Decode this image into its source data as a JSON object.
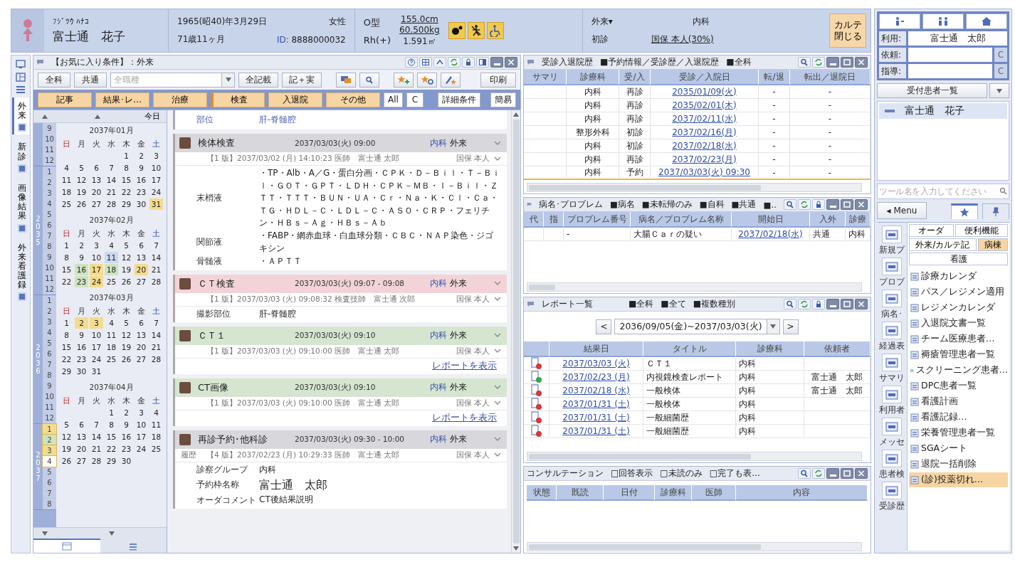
{
  "patient": {
    "kana": "ﾌｼﾞﾂｳ ﾊﾅｺ",
    "name": "富士通　花子",
    "birth": "1965(昭40)年3月29日",
    "age": "71歳11ヶ月",
    "sex": "女性",
    "id_label": "ID:",
    "id": "8888000032",
    "blood": "O型",
    "rh": "Rh(+)",
    "height": "155.0cm",
    "weight": "60.500kg",
    "bsa": "1.591㎡",
    "badges": [
      {
        "kind": "dots"
      },
      {
        "kind": "figure"
      },
      {
        "kind": "wheelchair"
      }
    ]
  },
  "visit": {
    "type": "外来▾",
    "dept": "内科",
    "visit_kind": "初診",
    "insurance": "国保 本人(30%)"
  },
  "close_button": "カルテ閉じる",
  "side_tabs": [
    {
      "label": "外来",
      "selected": true
    },
    {
      "label": "新診",
      "selected": false
    },
    {
      "label": "画像結果",
      "selected": false
    },
    {
      "label": "外来看護録",
      "selected": false
    }
  ],
  "favorites": {
    "title": "【お気に入り条件】：外来",
    "left_buttons": [
      "全科",
      "共通"
    ],
    "field_placeholder": "全職種",
    "mid_buttons": [
      "全記載",
      "記＋実"
    ],
    "print": "印刷",
    "filters": [
      {
        "label": "記事",
        "selected": false
      },
      {
        "label": "結果･レ…",
        "selected": false
      },
      {
        "label": "治療",
        "selected": false
      },
      {
        "label": "検査",
        "selected": true
      },
      {
        "label": "入退院",
        "selected": false
      },
      {
        "label": "その他",
        "selected": false
      }
    ],
    "small_buttons": [
      "All",
      "C"
    ],
    "detail": "詳細条件",
    "simple": "簡易"
  },
  "calendar": {
    "today": "今日",
    "strip": [
      {
        "months": [
          {
            "m": "9"
          },
          {
            "m": "10"
          },
          {
            "m": "11"
          },
          {
            "m": "12"
          }
        ]
      },
      {
        "year": "2035",
        "months": [
          {
            "m": "1"
          },
          {
            "m": "2"
          },
          {
            "m": "3"
          },
          {
            "m": "4"
          },
          {
            "m": "5"
          },
          {
            "m": "6"
          },
          {
            "m": "7"
          },
          {
            "m": "8"
          },
          {
            "m": "9"
          },
          {
            "m": "10"
          },
          {
            "m": "11"
          },
          {
            "m": "12"
          }
        ]
      },
      {
        "year": "2036",
        "months": [
          {
            "m": "1"
          },
          {
            "m": "2"
          },
          {
            "m": "3"
          },
          {
            "m": "4"
          },
          {
            "m": "5"
          },
          {
            "m": "6"
          },
          {
            "m": "7"
          },
          {
            "m": "8"
          },
          {
            "m": "9"
          },
          {
            "m": "10"
          },
          {
            "m": "11"
          },
          {
            "m": "12"
          }
        ]
      },
      {
        "year": "2037",
        "months": [
          {
            "m": "1",
            "color": "#f3dc8f"
          },
          {
            "m": "2",
            "color": "#cfe3c0"
          },
          {
            "m": "3",
            "color": "#f3dc8f"
          },
          {
            "m": "4",
            "color": "#ffffff"
          },
          {
            "m": "5"
          },
          {
            "m": "6"
          },
          {
            "m": "7"
          },
          {
            "m": "8"
          }
        ]
      }
    ],
    "months": [
      {
        "title": "2037年01月",
        "weekdays": [
          "日",
          "月",
          "火",
          "水",
          "木",
          "金",
          "土"
        ],
        "weeks": [
          [
            "1",
            "2",
            "3"
          ],
          [
            "4",
            "5",
            "6",
            "7",
            "8",
            "9",
            "10"
          ],
          [
            "11",
            "12",
            "13",
            "14",
            "15",
            "16",
            "17"
          ],
          [
            "18",
            "19",
            "20",
            "21",
            "22",
            "23",
            "24"
          ],
          [
            "25",
            "26",
            "27",
            "28",
            "29",
            "30",
            {
              "d": "31",
              "color": "#f3dc8f"
            }
          ]
        ]
      },
      {
        "title": "2037年02月",
        "weekdays": [
          "日",
          "月",
          "火",
          "水",
          "木",
          "金",
          "土"
        ],
        "weeks": [
          [
            "1",
            "2",
            "3",
            "4",
            "5",
            "6",
            "7"
          ],
          [
            "8",
            "9",
            "10",
            {
              "d": "11",
              "color": "#cdd8f0"
            },
            "12",
            "13",
            "14"
          ],
          [
            "15",
            {
              "d": "16",
              "color": "#cfe3c0"
            },
            {
              "d": "17",
              "color": "#f3dc8f"
            },
            {
              "d": "18",
              "color": "#cfe3c0"
            },
            "19",
            {
              "d": "20",
              "color": "#f3dc8f"
            },
            "21"
          ],
          [
            "22",
            {
              "d": "23",
              "color": "#cfe3c0"
            },
            {
              "d": "24",
              "color": "#f3dc8f"
            },
            "25",
            "26",
            "27",
            "28"
          ]
        ]
      },
      {
        "title": "2037年03月",
        "weekdays": [
          "日",
          "月",
          "火",
          "水",
          "木",
          "金",
          "土"
        ],
        "weeks": [
          [
            "1",
            {
              "d": "2",
              "color": "#f3dc8f"
            },
            {
              "d": "3",
              "color": "#f3dc8f"
            },
            "4",
            "5",
            "6",
            "7"
          ],
          [
            "8",
            "9",
            "10",
            "11",
            "12",
            "13",
            "14"
          ],
          [
            "15",
            "16",
            "17",
            "18",
            "19",
            "20",
            "21"
          ],
          [
            "22",
            "23",
            "24",
            "25",
            "26",
            "27",
            "28"
          ],
          [
            "29",
            "30",
            "31"
          ]
        ]
      },
      {
        "title": "2037年04月",
        "weekdays": [
          "日",
          "月",
          "火",
          "水",
          "木",
          "金",
          "土"
        ],
        "weeks": [
          [
            "1",
            "2",
            "3",
            "4"
          ],
          [
            "5",
            "6",
            "7",
            "8",
            "9",
            "10",
            "11"
          ],
          [
            "12",
            "13",
            "14",
            "15",
            "16",
            "17",
            "18"
          ],
          [
            "19",
            "20",
            "21",
            "22",
            "23",
            "24",
            "25"
          ],
          [
            "26",
            "27",
            "28",
            "29",
            "30"
          ]
        ]
      }
    ]
  },
  "timeline": {
    "fragment": {
      "label": "部位",
      "value": "肝-脊髄腔"
    },
    "cards": [
      {
        "title": "検体検査",
        "color": "#d8d8dc",
        "time": "2037/03/03(火) 09:00",
        "dept": "内科",
        "place": "外来",
        "version": "【1 版】2037/03/02 (月) 14:10:23 医師　富士通 太郎",
        "insurance": "国保 本人",
        "rows": [
          {
            "label": "末梢液",
            "value": "・TP・Alb・A／G・蛋白分画・ＣＰＫ・Ｄ－Ｂｉｌ・Ｔ－Ｂｉｌ・ＧＯＴ・ＧＰＴ・ＬＤＨ・ＣＰＫ－ＭＢ・Ｉ－Ｂｉｌ・ＺＴＴ・ＴＴＴ・ＢＵＮ・ＵＡ・Ｃｒ・Ｎａ・Ｋ・Ｃｌ・Ｃａ・ＴＧ・ＨＤＬ－Ｃ・ＬＤＬ－Ｃ・ＡＳＯ・ＣＲＰ・フェリチン・ＨＢｓ－Ａｇ・ＨＢｓ－Ａｂ"
          },
          {
            "label": "関節液",
            "value": "・FABP・網赤血球・白血球分類・ＣＢＣ・ＮＡＰ染色・ジゴキシン"
          },
          {
            "label": "骨髄液",
            "value": "・ＡＰＴＴ"
          }
        ]
      },
      {
        "title": "ＣＴ検査",
        "color": "#f2d4d8",
        "time": "2037/03/03(火) 09:07 - 09:08",
        "dept": "内科",
        "place": "外来",
        "version": "【1 版】2037/03/03 (火) 09:08:32 検査技師　富士通 次郎",
        "insurance": "国保 本人",
        "rows": [
          {
            "label": "撮影部位",
            "value": "肝-脊髄腔"
          }
        ]
      },
      {
        "title": "ＣＴ１",
        "color": "#d5e5d0",
        "time": "2037/03/03(火) 09:10",
        "dept": "内科",
        "place": "外来",
        "version": "【1 版】2037/03/03 (火) 09:10:00 医師　富士通 太郎",
        "insurance": "国保 本人",
        "link": "レポートを表示"
      },
      {
        "title": "CT画像",
        "color": "#d5e5d0",
        "time": "2037/03/03(火) 09:10",
        "dept": "内科",
        "place": "外来",
        "version": "【1 版】2037/03/03 (火) 09:10:00 医師　富士通 太郎",
        "insurance": "国保 本人",
        "link": "レポートを表示"
      },
      {
        "title": "再診予約･他科診",
        "color": "#d8d8dc",
        "time": "2037/03/03(火) 09:30 - 10:00",
        "dept": "内科",
        "place": "外来",
        "history": "履歴",
        "version": "【4 版】2037/02/23 (月) 10:29:33 医師　富士通 太郎",
        "insurance": "国保 本人",
        "rows": [
          {
            "label": "診察グループ",
            "value": "内科"
          },
          {
            "label": "予約枠名称",
            "value": "富士通　太郎",
            "large": true
          },
          {
            "label": "オーダコメント",
            "value": "CT後結果説明"
          }
        ]
      }
    ]
  },
  "visits": {
    "title": "受診入退院歴",
    "filters": [
      "■予約情報／受診歴／入退院歴",
      "■全科"
    ],
    "columns": [
      "サマリ",
      "診療科",
      "受/入",
      "受診／入院日",
      "転/退",
      "転出／退院日"
    ],
    "rows": [
      {
        "dept": "内科",
        "kind": "再診",
        "date": "2035/01/09(火)",
        "transfer": "-",
        "discharge": "-",
        "selected": false
      },
      {
        "dept": "内科",
        "kind": "再診",
        "date": "2035/02/01(木)",
        "transfer": "-",
        "discharge": "-",
        "selected": false
      },
      {
        "dept": "内科",
        "kind": "再診",
        "date": "2037/02/11(水)",
        "transfer": "-",
        "discharge": "-",
        "selected": false
      },
      {
        "dept": "整形外科",
        "kind": "初診",
        "date": "2037/02/16(月)",
        "transfer": "-",
        "discharge": "-",
        "selected": false
      },
      {
        "dept": "内科",
        "kind": "初診",
        "date": "2037/02/18(水)",
        "transfer": "-",
        "discharge": "-",
        "selected": false
      },
      {
        "dept": "内科",
        "kind": "再診",
        "date": "2037/02/23(月)",
        "transfer": "-",
        "discharge": "-",
        "selected": false
      },
      {
        "dept": "内科",
        "kind": "予約",
        "date": "2037/03/03(火) 09:30",
        "transfer": "-",
        "discharge": "-",
        "selected": true
      }
    ]
  },
  "problems": {
    "title": "病名･プロブレム",
    "filters": [
      "■病名",
      "■未転帰のみ",
      "■自科",
      "■共通",
      "■‥"
    ],
    "columns": [
      "代",
      "指",
      "プロブレム番号",
      "病名／プロブレム名称",
      "開始日",
      "入外",
      "診療"
    ],
    "rows": [
      {
        "number": "-",
        "name": "大腸Ｃａｒの疑い",
        "start": "2037/02/18(水)",
        "inout": "共通",
        "dept": "内科"
      }
    ]
  },
  "reports": {
    "title": "レポート一覧",
    "filters": [
      "■全科",
      "■全て",
      "■複数種別"
    ],
    "prev": "<",
    "range": "2036/09/05(金)~2037/03/03(火)",
    "next": ">",
    "columns": [
      "結果日",
      "タイトル",
      "診療科",
      "依頼者"
    ],
    "rows": [
      {
        "completed": false,
        "date": "2037/03/03 (火)",
        "title": "ＣＴ１",
        "dept": "内科"
      },
      {
        "completed": true,
        "date": "2037/02/23 (月)",
        "title": "内視鏡検査レポート",
        "dept": "内科",
        "requester": "富士通　太郎"
      },
      {
        "completed": false,
        "date": "2037/02/18 (水)",
        "title": "一般検体",
        "dept": "内科",
        "requester": "富士通　太郎"
      },
      {
        "completed": false,
        "date": "2037/01/31 (土)",
        "title": "一般検体",
        "dept": "内科"
      },
      {
        "completed": false,
        "date": "2037/01/31 (土)",
        "title": "一般細菌歴",
        "dept": "内科"
      },
      {
        "completed": false,
        "date": "2037/01/31 (土)",
        "title": "一般細菌歴",
        "dept": "内科"
      }
    ]
  },
  "consultation": {
    "title": "コンサルテーション",
    "filters": [
      "□回答表示",
      "□未読のみ",
      "□完了も表…"
    ],
    "columns": [
      "状態",
      "既読",
      "日付",
      "診療科",
      "医師",
      "内容"
    ]
  },
  "sidebar": {
    "user_label": "利用:",
    "user": "富士通　太郎",
    "request_label": "依頼:",
    "guide_label": "指導:",
    "clear_buttons": [
      "C",
      "C"
    ],
    "patient_list": {
      "title": "受付患者一覧",
      "items": [
        {
          "name": "富士通　花子",
          "selected": true
        }
      ]
    },
    "tool_search": {
      "placeholder": "ツール名を入力してください"
    },
    "menu_button": "◂ Menu",
    "tool_tabs": [
      {
        "kind": "star",
        "selected": true
      },
      {
        "kind": "pin",
        "selected": false
      }
    ],
    "launchers": [
      "新規プ",
      "プロブ",
      "病名･",
      "経過表",
      "サマリ",
      "利用者",
      "メッセ",
      "患者検",
      "受診歴"
    ],
    "categories": [
      {
        "label": "オーダ",
        "selected": false
      },
      {
        "label": "便利機能",
        "selected": false
      },
      {
        "label": "外来/カルテ記",
        "selected": false
      },
      {
        "label": "病棟",
        "selected": true
      },
      {
        "label": "看護",
        "selected": false
      }
    ],
    "tools": [
      {
        "label": "診療カレンダ",
        "selected": false
      },
      {
        "label": "パス／レジメン適用",
        "selected": false
      },
      {
        "label": "レジメンカレンダ",
        "selected": false
      },
      {
        "label": "入退院文書一覧",
        "selected": false
      },
      {
        "label": "チーム医療患者…",
        "selected": false
      },
      {
        "label": "褥瘡管理患者一覧",
        "selected": false
      },
      {
        "label": "スクリーニング患者…",
        "selected": false
      },
      {
        "label": "DPC患者一覧",
        "selected": false
      },
      {
        "label": "看護計画",
        "selected": false
      },
      {
        "label": "看護記録…",
        "selected": false
      },
      {
        "label": "栄養管理患者一覧",
        "selected": false
      },
      {
        "label": "SGAシート",
        "selected": false
      },
      {
        "label": "退院一括削除",
        "selected": false
      },
      {
        "label": "(診)投薬切れ…",
        "selected": true
      }
    ]
  }
}
